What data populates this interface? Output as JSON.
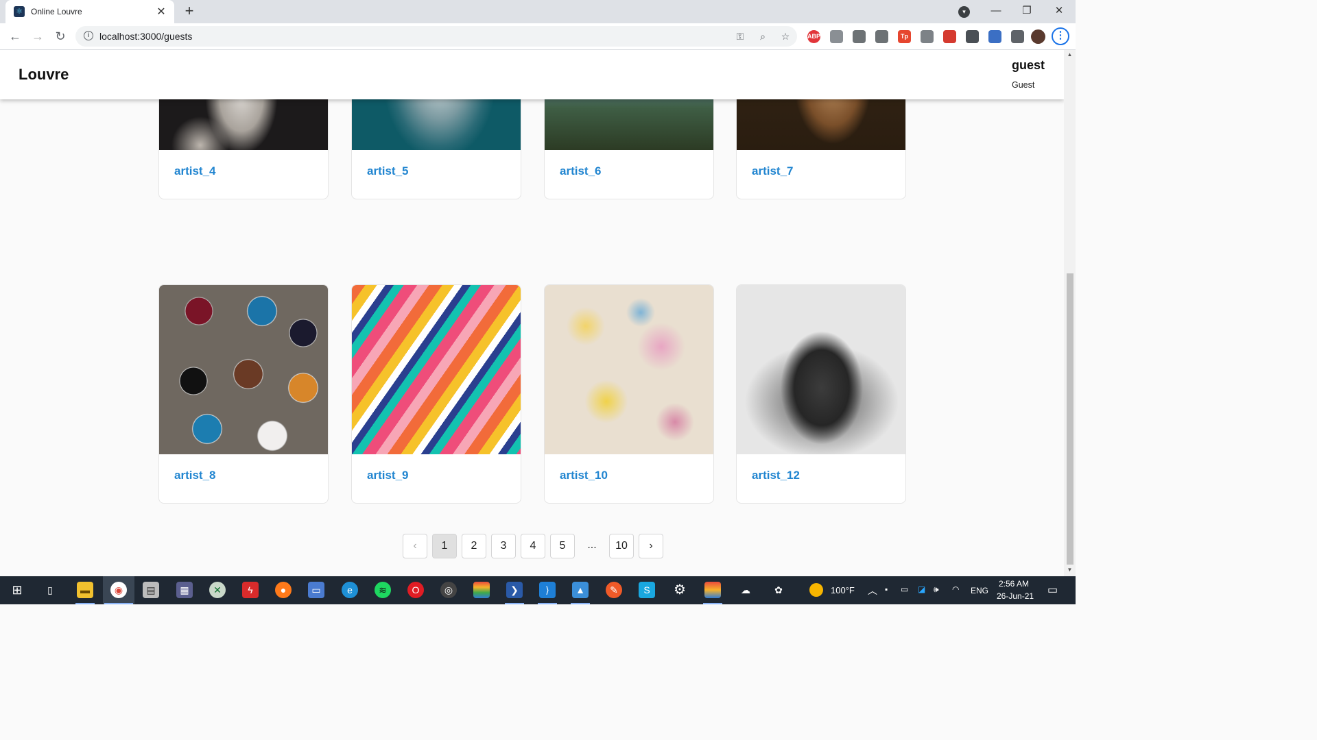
{
  "browser": {
    "tab_title": "Online Louvre",
    "url": "localhost:3000/guests",
    "extensions": [
      {
        "name": "abp-icon",
        "label": "ABP",
        "color": "#e2353a"
      },
      {
        "name": "pen-extension-icon",
        "label": "",
        "color": "#8a8f94"
      },
      {
        "name": "image-extension-icon",
        "label": "",
        "color": "#6d7275"
      },
      {
        "name": "link-extension-icon",
        "label": "",
        "color": "#6d7275"
      },
      {
        "name": "tp-extension-icon",
        "label": "Tp",
        "color": "#e6462f"
      },
      {
        "name": "v-extension-icon",
        "label": "",
        "color": "#7d8287"
      },
      {
        "name": "red-extension-icon",
        "label": "",
        "color": "#d53a2f"
      },
      {
        "name": "moon-extension-icon",
        "label": "",
        "color": "#4a4f55"
      },
      {
        "name": "glasses-extension-icon",
        "label": "",
        "color": "#3b6fc4"
      },
      {
        "name": "puzzle-extensions-icon",
        "label": "",
        "color": "#5f6368"
      }
    ]
  },
  "app": {
    "brand": "Louvre",
    "user_name": "guest",
    "user_role": "Guest"
  },
  "artists": [
    {
      "name": "artist_4"
    },
    {
      "name": "artist_5"
    },
    {
      "name": "artist_6"
    },
    {
      "name": "artist_7"
    },
    {
      "name": "artist_8"
    },
    {
      "name": "artist_9"
    },
    {
      "name": "artist_10"
    },
    {
      "name": "artist_12"
    }
  ],
  "pagination": {
    "prev": "‹",
    "pages": [
      "1",
      "2",
      "3",
      "4",
      "5"
    ],
    "ellipsis": "...",
    "last": "10",
    "next": "›",
    "active": "1"
  },
  "taskbar": {
    "weather": "100°F",
    "language": "ENG",
    "time": "2:56 AM",
    "date": "26-Jun-21"
  },
  "colors": {
    "link": "#2185d0",
    "taskbar": "#1f2833"
  }
}
